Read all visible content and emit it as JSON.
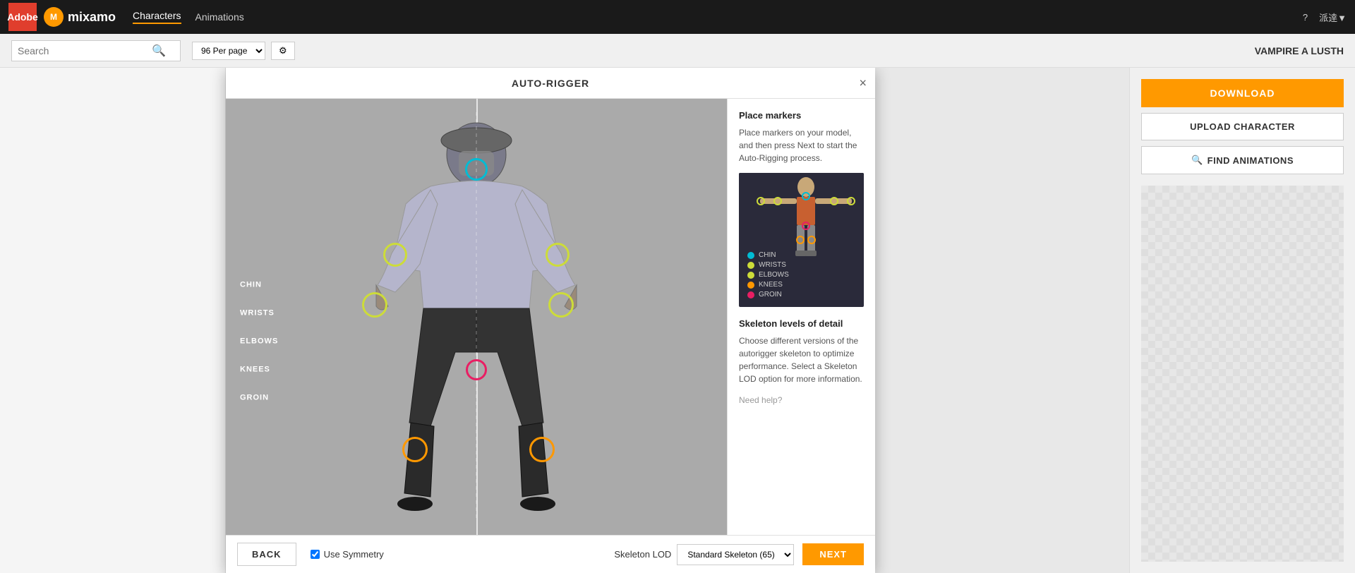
{
  "topnav": {
    "adobe_label": "Adobe",
    "logo_text": "mixamo",
    "logo_icon": "M",
    "nav_characters": "Characters",
    "nav_animations": "Animations",
    "help_icon": "?",
    "user_label": "派逹▼"
  },
  "subnav": {
    "search_placeholder": "Search",
    "per_page": "96 Per page",
    "header_right": "VAMPIRE A LUSTH"
  },
  "modal": {
    "title": "AUTO-RIGGER",
    "close_label": "×",
    "right_panel": {
      "markers_title": "Place markers",
      "markers_desc": "Place markers on your model, and then press Next to start the Auto-Rigging process.",
      "skeleton_title": "Skeleton levels of detail",
      "skeleton_desc": "Choose different versions of the autorigger skeleton to optimize performance. Select a Skeleton LOD option for more information.",
      "need_help": "Need help?"
    },
    "legend": {
      "chin_label": "CHIN",
      "wrists_label": "WRISTS",
      "elbows_label": "ELBOWS",
      "knees_label": "KNEES",
      "groin_label": "GROIN"
    },
    "legend_colors": {
      "chin": "#00bcd4",
      "wrists": "#cddc39",
      "elbows": "#cddc39",
      "knees": "#ff9800",
      "groin": "#e91e63"
    },
    "footer": {
      "back_label": "BACK",
      "use_symmetry_label": "Use Symmetry",
      "skeleton_lod_label": "Skeleton LOD",
      "skeleton_option": "Standard Skeleton (65)",
      "next_label": "NEXT"
    },
    "viewport_labels": {
      "chin": "CHIN",
      "wrists": "WRISTS",
      "elbows": "ELBOWS",
      "knees": "KNEES",
      "groin": "GROIN"
    }
  },
  "right_sidebar": {
    "download_label": "DOWNLOAD",
    "upload_label": "UPLOAD CHARACTER",
    "find_animations_label": "FIND ANIMATIONS",
    "find_icon": "🔍"
  }
}
